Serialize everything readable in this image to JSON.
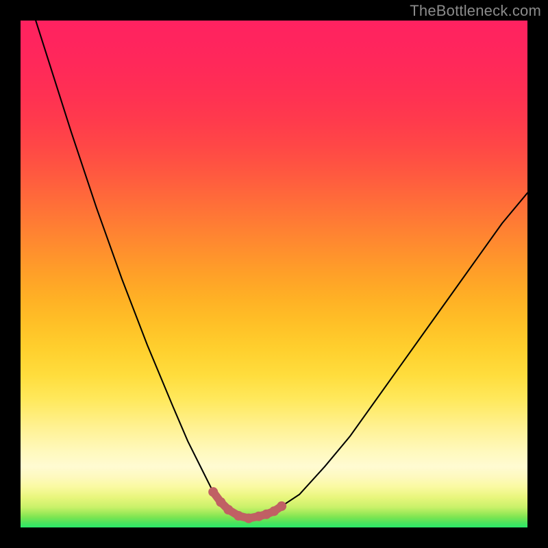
{
  "watermark": "TheBottleneck.com",
  "chart_data": {
    "type": "line",
    "title": "",
    "xlabel": "",
    "ylabel": "",
    "xlim": [
      0,
      100
    ],
    "ylim": [
      0,
      100
    ],
    "series": [
      {
        "name": "curve",
        "color": "#000000",
        "x": [
          3,
          10,
          15,
          20,
          25,
          30,
          33,
          36,
          38,
          39.5,
          41,
          43,
          45,
          47,
          50,
          55,
          60,
          65,
          70,
          75,
          80,
          85,
          90,
          95,
          100
        ],
        "y": [
          100,
          78,
          63,
          49,
          36,
          24,
          17,
          11,
          7,
          5,
          3.5,
          2.3,
          1.8,
          2.2,
          3.2,
          6.5,
          12,
          18,
          25,
          32,
          39,
          46,
          53,
          60,
          66
        ]
      },
      {
        "name": "highlight",
        "color": "#c06064",
        "x": [
          38,
          39.5,
          41,
          43,
          45,
          47,
          48.5,
          50,
          51.5
        ],
        "y": [
          7,
          5,
          3.5,
          2.3,
          1.8,
          2.2,
          2.6,
          3.2,
          4.2
        ]
      }
    ],
    "background_gradient": {
      "bottom": "#2ae869",
      "mid": "#ffee66",
      "top": "#ff2260"
    }
  }
}
